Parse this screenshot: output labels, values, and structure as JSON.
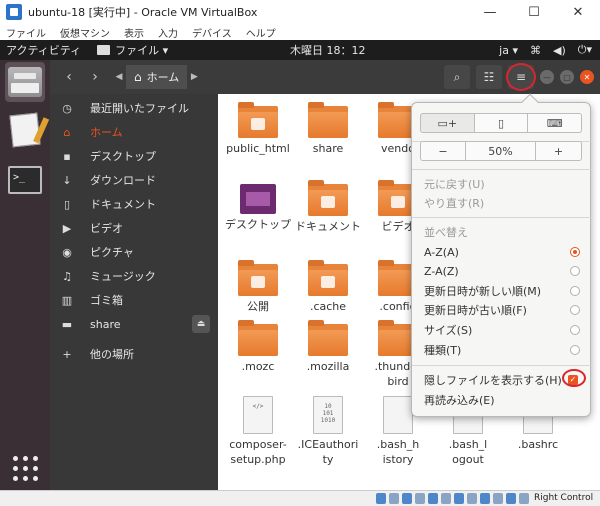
{
  "vbox": {
    "title": "ubuntu-18 [実行中] - Oracle VM VirtualBox",
    "menu": [
      "ファイル",
      "仮想マシン",
      "表示",
      "入力",
      "デバイス",
      "ヘルプ"
    ],
    "controls": {
      "minimize": "—",
      "maximize": "☐",
      "close": "✕"
    },
    "host_key": "Right Control"
  },
  "topbar": {
    "activities": "アクティビティ",
    "app_name": "ファイル ▾",
    "clock": "木曜日 18：12",
    "lang": "ja ▾"
  },
  "header": {
    "back": "‹",
    "forward": "›",
    "path_left": "◀",
    "path_right": "▶",
    "home_icon": "⌂",
    "location": "ホーム",
    "search_icon": "⌕",
    "view_icon": "☷",
    "menu_icon": "≡"
  },
  "sidebar": {
    "items": [
      {
        "icon": "◷",
        "label": "最近開いたファイル"
      },
      {
        "icon": "⌂",
        "label": "ホーム"
      },
      {
        "icon": "▪",
        "label": "デスクトップ"
      },
      {
        "icon": "↓",
        "label": "ダウンロード"
      },
      {
        "icon": "▯",
        "label": "ドキュメント"
      },
      {
        "icon": "▶",
        "label": "ビデオ"
      },
      {
        "icon": "◉",
        "label": "ピクチャ"
      },
      {
        "icon": "♫",
        "label": "ミュージック"
      },
      {
        "icon": "▥",
        "label": "ゴミ箱"
      },
      {
        "icon": "▬",
        "label": "share"
      },
      {
        "icon": "+",
        "label": "他の場所"
      }
    ],
    "eject_icon": "⏏"
  },
  "files": [
    {
      "name": "public_html",
      "kind": "folder"
    },
    {
      "name": "share",
      "kind": "folder"
    },
    {
      "name": "vendo",
      "kind": "folder"
    },
    {
      "name": "デスクトップ",
      "kind": "desktop"
    },
    {
      "name": "ドキュメント",
      "kind": "folder"
    },
    {
      "name": "ビデオ",
      "kind": "folder"
    },
    {
      "name": "公開",
      "kind": "folder"
    },
    {
      "name": ".cache",
      "kind": "folder"
    },
    {
      "name": ".config",
      "kind": "folder"
    },
    {
      "name": ".mozc",
      "kind": "folder"
    },
    {
      "name": ".mozilla",
      "kind": "folder"
    },
    {
      "name": ".thunderbird",
      "kind": "folder"
    },
    {
      "name": "composer-setup.php",
      "kind": "doc"
    },
    {
      "name": ".ICEauthority",
      "kind": "doc"
    },
    {
      "name": ".bash_history",
      "kind": "doc"
    },
    {
      "name": ".bash_logout",
      "kind": "doc"
    },
    {
      "name": ".bashrc",
      "kind": "doc"
    }
  ],
  "popover": {
    "zoom": "50%",
    "zoom_out": "−",
    "zoom_in": "+",
    "undo": "元に戻す(U)",
    "redo": "やり直す(R)",
    "sort_header": "並べ替え",
    "sort_options": [
      {
        "label": "A-Z(A)",
        "selected": true
      },
      {
        "label": "Z-A(Z)",
        "selected": false
      },
      {
        "label": "更新日時が新しい順(M)",
        "selected": false
      },
      {
        "label": "更新日時が古い順(F)",
        "selected": false
      },
      {
        "label": "サイズ(S)",
        "selected": false
      },
      {
        "label": "種類(T)",
        "selected": false
      }
    ],
    "show_hidden": "隠しファイルを表示する(H)",
    "show_hidden_checked": true,
    "reload": "再読み込み(E)"
  },
  "accent_color": "#e95420"
}
